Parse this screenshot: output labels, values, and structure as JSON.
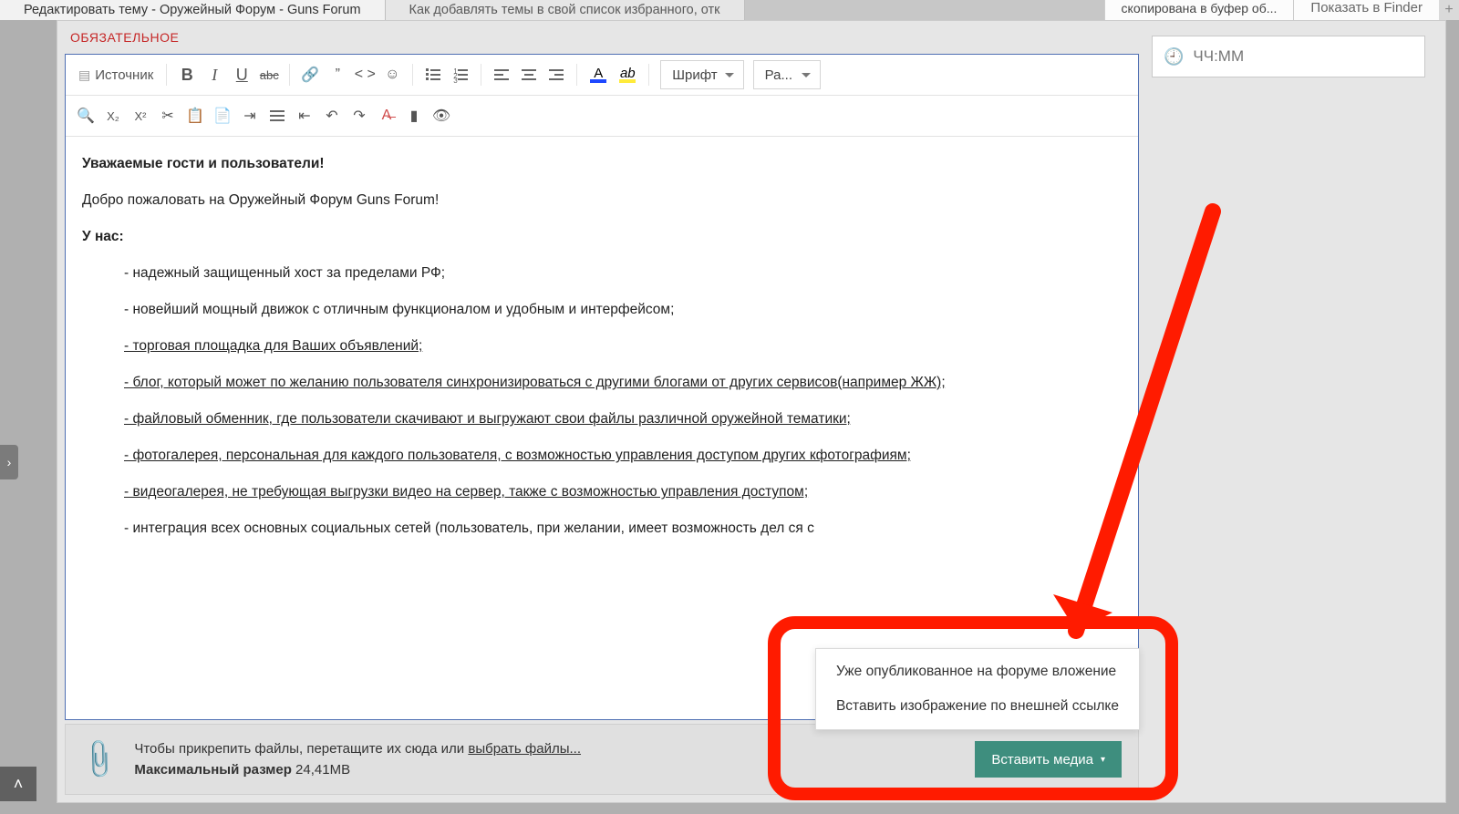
{
  "tabs": {
    "active": "Редактировать тему - Оружейный Форум - Guns Forum",
    "other": "Как добавлять темы в свой список избранного, отк",
    "notification": "скопирована в буфер об...",
    "finder": "Показать в Finder"
  },
  "section_label": "ОБЯЗАТЕЛЬНОЕ",
  "toolbar": {
    "source": "Источник",
    "font_combo": "Шрифт",
    "size_combo": "Ра..."
  },
  "icons": {
    "bold": "B",
    "italic": "I",
    "underline": "U",
    "strike": "abc",
    "link": "🔗",
    "quote": "”",
    "code": "< >",
    "emoji": "☺",
    "undo": "↶",
    "redo": "↷",
    "sub": "X₂",
    "sup": "X²",
    "cut": "✂",
    "paste": "📋",
    "paste_word": "📄",
    "page": "▤",
    "eye": "👁",
    "eraser": "⌫",
    "files": "📑"
  },
  "editor": {
    "greeting_bold": "Уважаемые гости и пользователи!",
    "welcome": "Добро пожаловать на Оружейный Форум Guns Forum!",
    "we_have": "У нас:",
    "bullets": {
      "b1": "- надежный защищенный хост за пределами РФ;",
      "b2": "- новейший мощный движок с отличным функционалом и удобным и интерфейсом;",
      "b3": "- торговая площадка для Ваших объявлений;",
      "b4": "- блог, который может по желанию пользователя синхронизироваться с другими блогами от других сервисов(например ЖЖ);",
      "b5": "- файловый обменник, где пользователи скачивают и выгружают свои файлы различной оружейной тематики;",
      "b6": "- фотогалерея, персональная для каждого пользователя, с возможностью управления доступом других кфотографиям;",
      "b7": "- видеогалерея, не требующая выгрузки видео на сервер, также с возможностью управления доступом;",
      "b8": "- интеграция всех основных социальных сетей (пользователь, при желании, имеет возможность дел        ся с"
    }
  },
  "attach": {
    "hint_prefix": "Чтобы прикрепить файлы, перетащите их сюда или ",
    "hint_link": "выбрать файлы...",
    "max_label": "Максимальный размер",
    "max_value": "24,41MB"
  },
  "insert_media": {
    "button": "Вставить медиа",
    "menu1": "Уже опубликованное на форуме вложение",
    "menu2": "Вставить изображение по внешней ссылке"
  },
  "sidebar": {
    "time_placeholder": "ЧЧ:MM"
  }
}
